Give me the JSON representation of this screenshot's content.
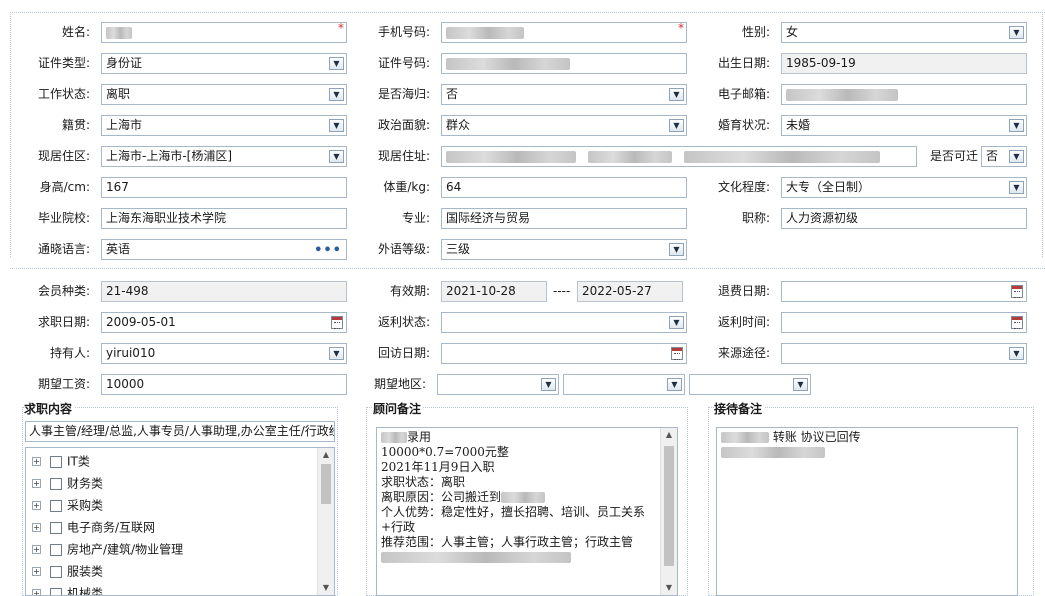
{
  "personal": {
    "name": {
      "label": "姓名:",
      "value": "",
      "required": "*"
    },
    "mobile": {
      "label": "手机号码:",
      "value": "",
      "required": "*"
    },
    "gender": {
      "label": "性别:",
      "value": "女"
    },
    "id_type": {
      "label": "证件类型:",
      "value": "身份证"
    },
    "id_number": {
      "label": "证件号码:",
      "value": ""
    },
    "birth_date": {
      "label": "出生日期:",
      "value": "1985-09-19"
    },
    "work_status": {
      "label": "工作状态:",
      "value": "离职"
    },
    "returnee": {
      "label": "是否海归:",
      "value": "否"
    },
    "email": {
      "label": "电子邮箱:",
      "value": ""
    },
    "native_place": {
      "label": "籍贯:",
      "value": "上海市"
    },
    "political": {
      "label": "政治面貌:",
      "value": "群众"
    },
    "marital": {
      "label": "婚育状况:",
      "value": "未婚"
    },
    "residence_area": {
      "label": "现居住区:",
      "value": "上海市-上海市-[杨浦区]"
    },
    "address": {
      "label": "现居住址:",
      "value": ""
    },
    "relocate": {
      "label": "是否可迁",
      "value": "否"
    },
    "height": {
      "label": "身高/cm:",
      "value": "167"
    },
    "weight": {
      "label": "体重/kg:",
      "value": "64"
    },
    "education": {
      "label": "文化程度:",
      "value": "大专（全日制）"
    },
    "school": {
      "label": "毕业院校:",
      "value": "上海东海职业技术学院"
    },
    "major": {
      "label": "专业:",
      "value": "国际经济与贸易"
    },
    "title": {
      "label": "职称:",
      "value": "人力资源初级"
    },
    "language": {
      "label": "通晓语言:",
      "value": "英语"
    },
    "language_level": {
      "label": "外语等级:",
      "value": "三级"
    }
  },
  "membership": {
    "member_type": {
      "label": "会员种类:",
      "value": "21-498"
    },
    "validity": {
      "label": "有效期:",
      "start": "2021-10-28",
      "separator": "----",
      "end": "2022-05-27"
    },
    "refund_date": {
      "label": "退费日期:",
      "value": ""
    },
    "job_seek_date": {
      "label": "求职日期:",
      "value": "2009-05-01"
    },
    "rebate_status": {
      "label": "返利状态:",
      "value": ""
    },
    "rebate_time": {
      "label": "返利时间:",
      "value": ""
    },
    "holder": {
      "label": "持有人:",
      "value": "yirui010"
    },
    "visit_date": {
      "label": "回访日期:",
      "value": ""
    },
    "source": {
      "label": "来源途径:",
      "value": ""
    },
    "expected_salary": {
      "label": "期望工资:",
      "value": "10000"
    },
    "expected_region": {
      "label": "期望地区:",
      "values": [
        "",
        "",
        ""
      ]
    }
  },
  "job_content": {
    "title": "求职内容",
    "selected": "人事主管/经理/总监,人事专员/人事助理,办公室主任/行政经",
    "tree": [
      "IT类",
      "财务类",
      "采购类",
      "电子商务/互联网",
      "房地产/建筑/物业管理",
      "服装类",
      "机械类"
    ]
  },
  "advisor_notes": {
    "title": "顾问备注",
    "lines": [
      "录用",
      "10000*0.7=7000元整",
      "2021年11月9日入职",
      "",
      "",
      "求职状态：离职",
      "离职原因：公司搬迁到",
      "个人优势：稳定性好，擅长招聘、培训、员工关系",
      "+行政",
      "推荐范围：人事主管；人事行政主管；行政主管"
    ]
  },
  "reception_notes": {
    "title": "接待备注",
    "lines": [
      "转账 协议已回传",
      ""
    ]
  }
}
